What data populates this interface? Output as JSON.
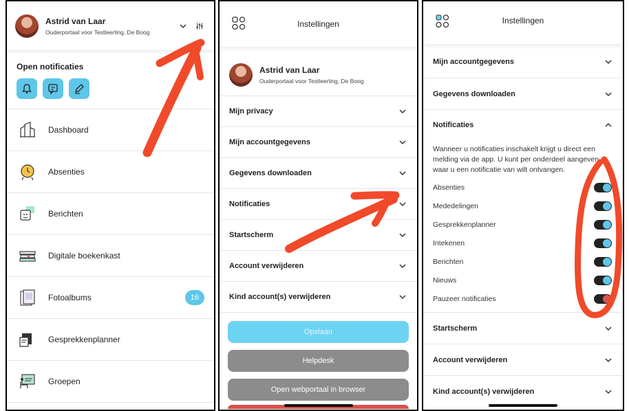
{
  "panel1": {
    "user": {
      "name": "Astrid van Laar",
      "subtitle": "Ouderportaal voor Testleerling, De Boog"
    },
    "open_notifications_title": "Open notificaties",
    "menu": [
      {
        "label": "Dashboard",
        "icon": "dashboard-icon"
      },
      {
        "label": "Absenties",
        "icon": "absences-icon"
      },
      {
        "label": "Berichten",
        "icon": "messages-icon"
      },
      {
        "label": "Digitale boekenkast",
        "icon": "bookshelf-icon"
      },
      {
        "label": "Fotoalbums",
        "icon": "photo-album-icon",
        "badge": "16"
      },
      {
        "label": "Gesprekkenplanner",
        "icon": "meeting-planner-icon"
      },
      {
        "label": "Groepen",
        "icon": "groups-icon"
      }
    ]
  },
  "panel2": {
    "title": "Instellingen",
    "user": {
      "name": "Astrid van Laar",
      "subtitle": "Ouderportaal voor Testleerling, De Boog"
    },
    "sections": [
      "Mijn privacy",
      "Mijn accountgegevens",
      "Gegevens downloaden",
      "Notificaties",
      "Startscherm",
      "Account verwijderen",
      "Kind account(s) verwijderen"
    ],
    "buttons": {
      "save": "Opslaan",
      "helpdesk": "Helpdesk",
      "open_webportal": "Open webportaal in browser"
    }
  },
  "panel3": {
    "title": "Instellingen",
    "sections_top": [
      "Mijn accountgegevens",
      "Gegevens downloaden"
    ],
    "notifications": {
      "title": "Notificaties",
      "description": "Wanneer u notificaties inschakelt krijgt u direct een melding via de app. U kunt per onderdeel aangeven waar u een notificatie van wilt ontvangen.",
      "toggles": [
        {
          "label": "Absenties",
          "on": true
        },
        {
          "label": "Mededelingen",
          "on": true
        },
        {
          "label": "Gesprekkenplanner",
          "on": true
        },
        {
          "label": "Intekenen",
          "on": true
        },
        {
          "label": "Berichten",
          "on": true
        },
        {
          "label": "Nieuws",
          "on": true
        },
        {
          "label": "Pauzeer notificaties",
          "on": false
        }
      ]
    },
    "sections_bottom": [
      "Startscherm",
      "Account verwijderen",
      "Kind account(s) verwijderen"
    ]
  },
  "colors": {
    "accent": "#5ec6e8",
    "annotation": "#f04a2a",
    "paused": "#d9534f"
  }
}
